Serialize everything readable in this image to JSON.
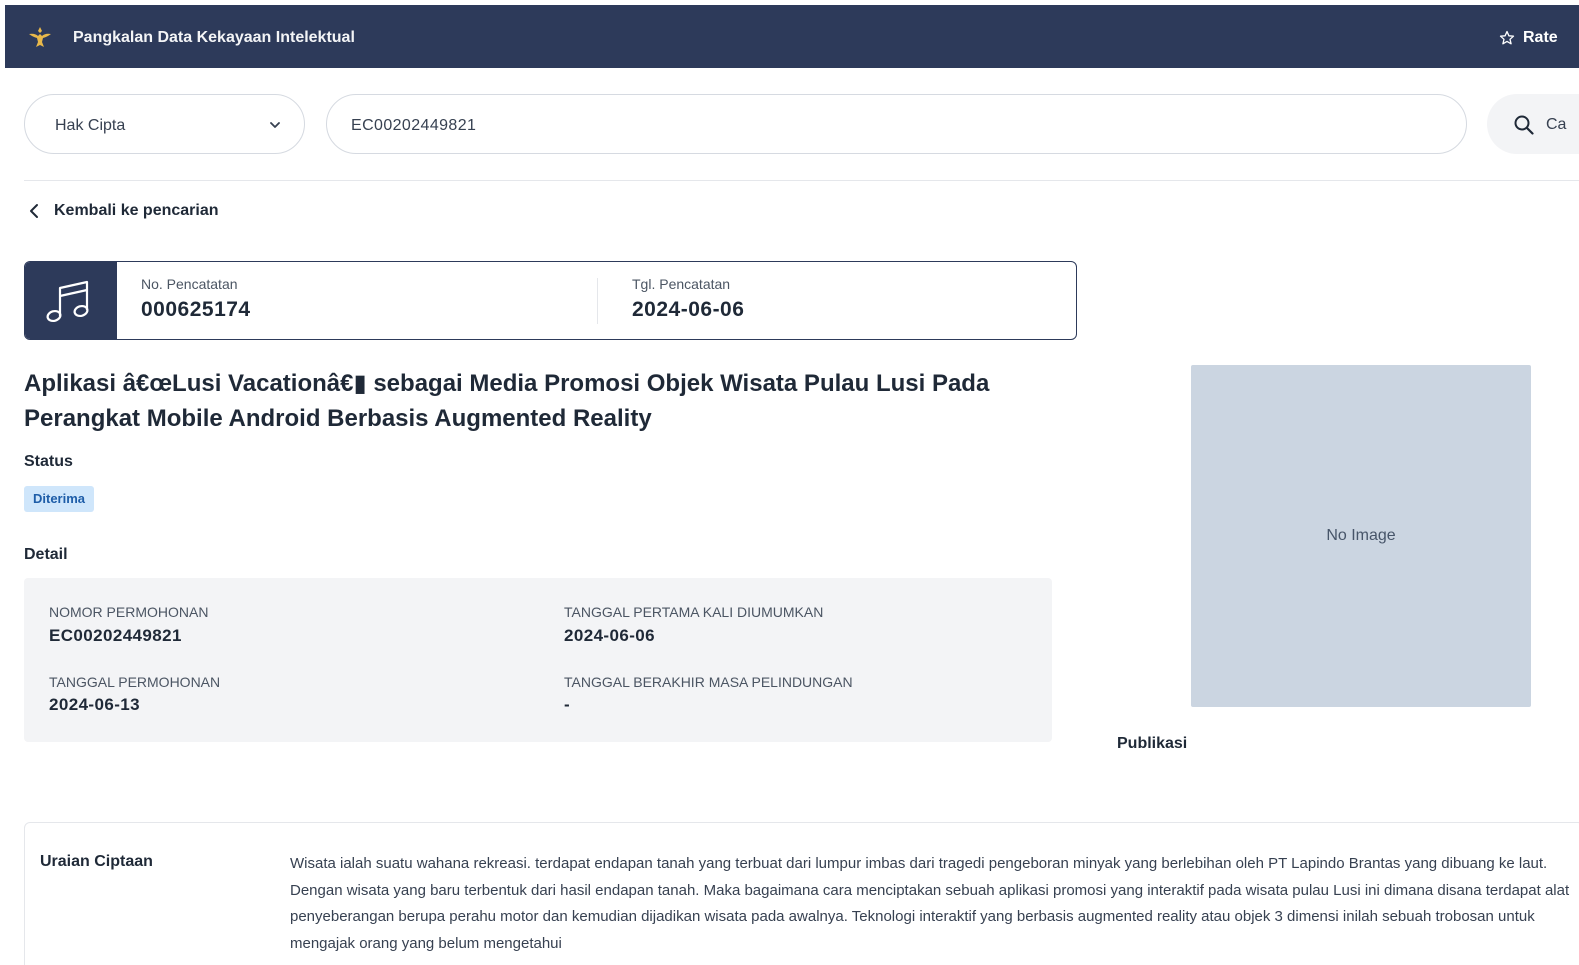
{
  "header": {
    "app_title": "Pangkalan Data Kekayaan Intelektual",
    "rate_label": "Rate"
  },
  "search": {
    "category": "Hak Cipta",
    "query": "EC00202449821",
    "button_label": "Ca"
  },
  "nav": {
    "back_label": "Kembali ke pencarian"
  },
  "record": {
    "icon": "music-note-icon",
    "no_label": "No. Pencatatan",
    "no_value": "000625174",
    "date_label": "Tgl. Pencatatan",
    "date_value": "2024-06-06",
    "title": "Aplikasi â€œLusi Vacationâ€▮ sebagai Media Promosi Objek Wisata Pulau Lusi Pada Perangkat Mobile Android Berbasis Augmented Reality",
    "status_label": "Status",
    "status_value": "Diterima",
    "detail_label": "Detail",
    "details": {
      "nomor_permohonan_label": "NOMOR PERMOHONAN",
      "nomor_permohonan": "EC00202449821",
      "tanggal_diumumkan_label": "TANGGAL PERTAMA KALI DIUMUMKAN",
      "tanggal_diumumkan": "2024-06-06",
      "tanggal_permohonan_label": "TANGGAL PERMOHONAN",
      "tanggal_permohonan": "2024-06-13",
      "tanggal_berakhir_label": "TANGGAL BERAKHIR MASA PELINDUNGAN",
      "tanggal_berakhir": "-"
    },
    "image_placeholder": "No Image",
    "publikasi_label": "Publikasi",
    "uraian_label": "Uraian Ciptaan",
    "uraian_text": "Wisata ialah suatu wahana rekreasi. terdapat endapan tanah yang terbuat dari lumpur imbas dari tragedi pengeboran minyak yang berlebihan oleh PT Lapindo Brantas yang dibuang ke laut. Dengan wisata yang baru terbentuk dari hasil endapan tanah. Maka bagaimana cara menciptakan sebuah aplikasi promosi yang interaktif pada wisata pulau Lusi ini dimana disana terdapat alat penyeberangan berupa perahu motor dan kemudian dijadikan wisata pada awalnya. Teknologi interaktif yang berbasis augmented reality atau objek 3 dimensi inilah sebuah trobosan untuk mengajak orang yang belum mengetahui"
  },
  "colors": {
    "header_bg": "#2d3a5a",
    "badge_bg": "#cfe6fb",
    "badge_text": "#1e5da8"
  }
}
